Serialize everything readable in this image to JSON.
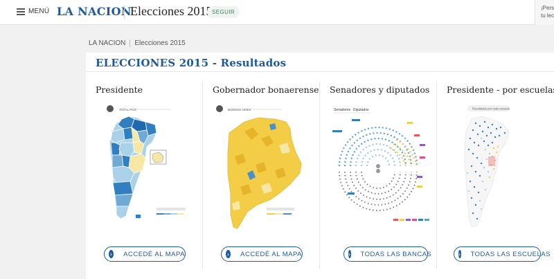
{
  "header": {
    "menu_label": "MENÚ",
    "logo_text": "LA NACION",
    "section_title": "Elecciones 2015",
    "follow_label": "SEGUIR",
    "side_teaser_line1": "¡Pers",
    "side_teaser_line2": "tu lec"
  },
  "breadcrumb": {
    "home": "LA NACION",
    "current": "Elecciones 2015"
  },
  "main": {
    "title": "ELECCIONES 2015 - Resultados",
    "cards": [
      {
        "title": "Presidente",
        "button_label": "ACCEDÉ AL MAPA",
        "thumb_caption": "TOTAL PAÍS"
      },
      {
        "title": "Gobernador bonaerense",
        "button_label": "ACCEDÉ AL MAPA",
        "thumb_caption": "BUENOS AIRES"
      },
      {
        "title": "Senadores y diputados",
        "button_label": "TODAS LAS BANCAS",
        "thumb_tabs": [
          "Senadores",
          "Diputados"
        ]
      },
      {
        "title": "Presidente - por escuelas",
        "button_label": "TODAS LAS ESCUELAS",
        "thumb_caption": "Resultados por cada escuela"
      }
    ]
  },
  "colors": {
    "brand_blue": "#1c5aa0",
    "follow_green": "#3f7d5c",
    "map_blue": "#2f7fc1",
    "map_light_blue": "#a9d1ea",
    "map_yellow": "#f3cd45",
    "map_pale_yellow": "#f7e7a5"
  }
}
